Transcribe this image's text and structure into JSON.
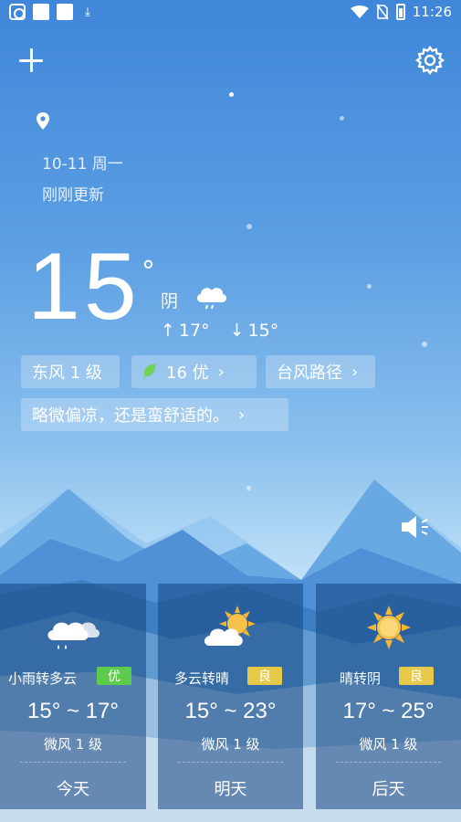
{
  "status_bar": {
    "time": "11:26",
    "icons": [
      "screen-rotate-icon",
      "notification-square-icon",
      "notification-square-icon",
      "download-icon",
      "wifi-icon",
      "no-sim-icon",
      "battery-icon"
    ]
  },
  "header": {
    "add_icon": "plus-icon",
    "settings_icon": "gear-icon",
    "location_icon": "location-pin-icon",
    "date": "10-11  周一",
    "updated": "刚刚更新"
  },
  "current": {
    "temperature": "15",
    "degree_symbol": "°",
    "condition": "阴",
    "condition_icon": "cloud-rain-icon",
    "high": "17°",
    "low": "15°"
  },
  "chips": {
    "wind": "东风 1 级",
    "aqi": "16 优",
    "typhoon": "台风路径",
    "tip": "略微偏凉，还是蛮舒适的。"
  },
  "speaker_icon": "speaker-icon",
  "colors": {
    "aqi_good": "#5ecb4c",
    "aqi_moderate": "#e7c94a",
    "sun": "#f7b733"
  },
  "forecast": [
    {
      "condition": "小雨转多云",
      "aqi": "优",
      "temp": "15° ~ 17°",
      "wind": "微风 1 级",
      "day": "今天",
      "icon": "cloud-rain-icon"
    },
    {
      "condition": "多云转晴",
      "aqi": "良",
      "temp": "15° ~ 23°",
      "wind": "微风 1 级",
      "day": "明天",
      "icon": "sun-cloud-icon"
    },
    {
      "condition": "晴转阴",
      "aqi": "良",
      "temp": "17° ~ 25°",
      "wind": "微风 1 级",
      "day": "后天",
      "icon": "sun-icon"
    }
  ]
}
